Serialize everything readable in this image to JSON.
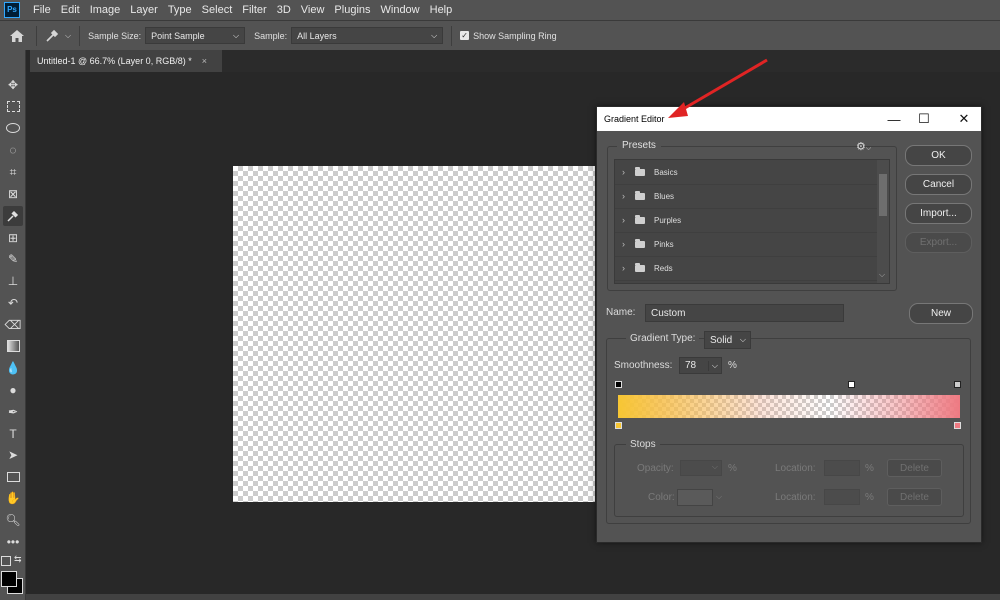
{
  "menubar": {
    "items": [
      "File",
      "Edit",
      "Image",
      "Layer",
      "Type",
      "Select",
      "Filter",
      "3D",
      "View",
      "Plugins",
      "Window",
      "Help"
    ],
    "logo_text": "Ps"
  },
  "options_bar": {
    "sample_size_label": "Sample Size:",
    "sample_size_value": "Point Sample",
    "sample_label": "Sample:",
    "sample_value": "All Layers",
    "show_ring_label": "Show Sampling Ring",
    "show_ring_checked": true
  },
  "document": {
    "tab_title": "Untitled-1 @ 66.7% (Layer 0, RGB/8) *",
    "close_glyph": "×"
  },
  "tools": [
    "move-tool-icon",
    "marquee-tool-icon",
    "lasso-tool-icon",
    "quick-selection-icon",
    "crop-tool-icon",
    "frame-tool-icon",
    "eyedropper-tool-icon",
    "healing-brush-icon",
    "brush-tool-icon",
    "clone-stamp-icon",
    "history-brush-icon",
    "eraser-tool-icon",
    "gradient-tool-icon",
    "blur-tool-icon",
    "dodge-tool-icon",
    "pen-tool-icon",
    "type-tool-icon",
    "path-selection-icon",
    "rectangle-tool-icon",
    "hand-tool-icon",
    "zoom-tool-icon",
    "more-tools-icon"
  ],
  "dialog": {
    "title": "Gradient Editor",
    "presets_label": "Presets",
    "presets": [
      "Basics",
      "Blues",
      "Purples",
      "Pinks",
      "Reds"
    ],
    "buttons": {
      "ok": "OK",
      "cancel": "Cancel",
      "import": "Import...",
      "export": "Export...",
      "new": "New"
    },
    "name_label": "Name:",
    "name_value": "Custom",
    "gradient_type_label": "Gradient Type:",
    "gradient_type_value": "Solid",
    "smoothness_label": "Smoothness:",
    "smoothness_value": "78",
    "percent": "%",
    "stops": {
      "label": "Stops",
      "opacity_label": "Opacity:",
      "color_label": "Color:",
      "location_label": "Location:",
      "delete_label": "Delete"
    },
    "gradient_colors": {
      "start": "#f7c633",
      "end": "#ee7a82"
    }
  }
}
